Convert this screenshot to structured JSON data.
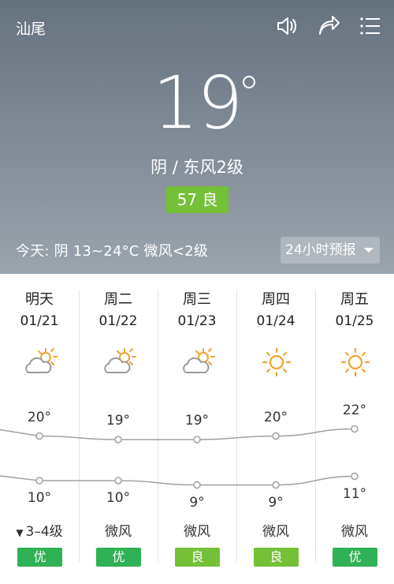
{
  "header": {
    "city": "汕尾",
    "icons": [
      "speaker-icon",
      "share-icon",
      "menu-icon"
    ]
  },
  "current": {
    "temperature": "19",
    "condition": "阴 / 东风2级",
    "aqi": "57 良",
    "aqi_color": "#74c037"
  },
  "today_summary": "今天:  阴   13~24°C   微风<2级",
  "hourly_button": "24小时预报",
  "forecast": [
    {
      "day": "明天",
      "date": "01/21",
      "icon": "partly-cloudy-icon",
      "high": "20°",
      "low": "10°",
      "wind": "3–4级",
      "wind_arrow": "▼",
      "aqi": "优",
      "aqi_color": "#2fb155",
      "high_val": 20,
      "low_val": 10
    },
    {
      "day": "周二",
      "date": "01/22",
      "icon": "partly-cloudy-icon",
      "high": "19°",
      "low": "10°",
      "wind": "微风",
      "wind_arrow": "",
      "aqi": "优",
      "aqi_color": "#2fb155",
      "high_val": 19,
      "low_val": 10
    },
    {
      "day": "周三",
      "date": "01/23",
      "icon": "partly-cloudy-icon",
      "high": "19°",
      "low": "9°",
      "wind": "微风",
      "wind_arrow": "",
      "aqi": "良",
      "aqi_color": "#74c037",
      "high_val": 19,
      "low_val": 9
    },
    {
      "day": "周四",
      "date": "01/24",
      "icon": "sun-icon",
      "high": "20°",
      "low": "9°",
      "wind": "微风",
      "wind_arrow": "",
      "aqi": "良",
      "aqi_color": "#74c037",
      "high_val": 20,
      "low_val": 9
    },
    {
      "day": "周五",
      "date": "01/25",
      "icon": "sun-icon",
      "high": "22°",
      "low": "11°",
      "wind": "微风",
      "wind_arrow": "",
      "aqi": "优",
      "aqi_color": "#2fb155",
      "high_val": 22,
      "low_val": 11
    }
  ]
}
